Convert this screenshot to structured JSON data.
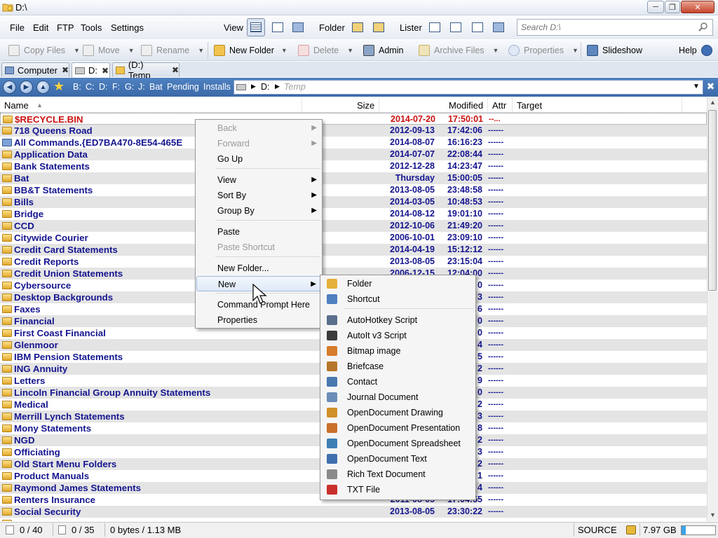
{
  "window": {
    "title": "D:\\"
  },
  "menu": {
    "items": [
      "File",
      "Edit",
      "FTP",
      "Tools",
      "Settings"
    ]
  },
  "toolbar_groups": {
    "view_label": "View",
    "folder_label": "Folder",
    "lister_label": "Lister"
  },
  "search": {
    "placeholder": "Search D:\\"
  },
  "actions": {
    "copy_files": "Copy Files",
    "move": "Move",
    "rename": "Rename",
    "new_folder": "New Folder",
    "delete": "Delete",
    "admin": "Admin",
    "archive_files": "Archive Files",
    "properties": "Properties",
    "slideshow": "Slideshow",
    "help": "Help"
  },
  "tabs": [
    {
      "label": "Computer"
    },
    {
      "label": "D:"
    },
    {
      "label": "(D:) Temp"
    }
  ],
  "pathbar": {
    "drives": [
      "B:",
      "C:",
      "D:",
      "F:",
      "G:",
      "J:"
    ],
    "bookmarks": [
      "Bat",
      "Pending",
      "Installs"
    ],
    "current_drive": "D:",
    "current_folder": "Temp"
  },
  "columns": {
    "name": "Name",
    "size": "Size",
    "modified": "Modified",
    "attr": "Attr",
    "target": "Target"
  },
  "files": [
    {
      "name": "$RECYCLE.BIN",
      "date": "2014-07-20",
      "time": "17:50:01",
      "attr": "--..."
    },
    {
      "name": "718 Queens Road",
      "date": "2012-09-13",
      "time": "17:42:06",
      "attr": "------"
    },
    {
      "name": "All Commands.{ED7BA470-8E54-465E",
      "date": "2014-08-07",
      "time": "16:16:23",
      "attr": "------"
    },
    {
      "name": "Application Data",
      "date": "2014-07-07",
      "time": "22:08:44",
      "attr": "------"
    },
    {
      "name": "Bank Statements",
      "date": "2012-12-28",
      "time": "14:23:47",
      "attr": "------"
    },
    {
      "name": "Bat",
      "date": "Thursday",
      "time": "15:00:05",
      "attr": "------"
    },
    {
      "name": "BB&T Statements",
      "date": "2013-08-05",
      "time": "23:48:58",
      "attr": "------"
    },
    {
      "name": "Bills",
      "date": "2014-03-05",
      "time": "10:48:53",
      "attr": "------"
    },
    {
      "name": "Bridge",
      "date": "2014-08-12",
      "time": "19:01:10",
      "attr": "------"
    },
    {
      "name": "CCD",
      "date": "2012-10-06",
      "time": "21:49:20",
      "attr": "------"
    },
    {
      "name": "Citywide Courier",
      "date": "2006-10-01",
      "time": "23:09:10",
      "attr": "------"
    },
    {
      "name": "Credit Card Statements",
      "date": "2014-04-19",
      "time": "15:12:12",
      "attr": "------"
    },
    {
      "name": "Credit Reports",
      "date": "2013-08-05",
      "time": "23:15:04",
      "attr": "------"
    },
    {
      "name": "Credit Union Statements",
      "date": "2006-12-15",
      "time": "12:04:00",
      "attr": "------"
    },
    {
      "name": "Cybersource",
      "date": "",
      "time": "0",
      "attr": "------"
    },
    {
      "name": "Desktop Backgrounds",
      "date": "",
      "time": "3",
      "attr": "------"
    },
    {
      "name": "Faxes",
      "date": "",
      "time": "6",
      "attr": "------"
    },
    {
      "name": "Financial",
      "date": "",
      "time": "0",
      "attr": "------"
    },
    {
      "name": "First Coast Financial",
      "date": "",
      "time": "0",
      "attr": "------"
    },
    {
      "name": "Glenmoor",
      "date": "",
      "time": "4",
      "attr": "------"
    },
    {
      "name": "IBM Pension Statements",
      "date": "",
      "time": "5",
      "attr": "------"
    },
    {
      "name": "ING Annuity",
      "date": "",
      "time": "2",
      "attr": "------"
    },
    {
      "name": "Letters",
      "date": "",
      "time": "9",
      "attr": "------"
    },
    {
      "name": "Lincoln Financial Group Annuity Statements",
      "date": "",
      "time": "0",
      "attr": "------"
    },
    {
      "name": "Medical",
      "date": "",
      "time": "2",
      "attr": "------"
    },
    {
      "name": "Merrill Lynch Statements",
      "date": "",
      "time": "3",
      "attr": "------"
    },
    {
      "name": "Mony Statements",
      "date": "",
      "time": "8",
      "attr": "------"
    },
    {
      "name": "NGD",
      "date": "",
      "time": "2",
      "attr": "------"
    },
    {
      "name": "Officiating",
      "date": "",
      "time": "3",
      "attr": "------"
    },
    {
      "name": "Old Start Menu Folders",
      "date": "",
      "time": "2",
      "attr": "------"
    },
    {
      "name": "Product Manuals",
      "date": "",
      "time": "1",
      "attr": "------"
    },
    {
      "name": "Raymond James Statements",
      "date": "",
      "time": "4",
      "attr": "------"
    },
    {
      "name": "Renters Insurance",
      "date": "2011-08-05",
      "time": "17:04:55",
      "attr": "------"
    },
    {
      "name": "Social Security",
      "date": "2013-08-05",
      "time": "23:30:22",
      "attr": "------"
    },
    {
      "name": "",
      "date": "",
      "time": "",
      "attr": ""
    }
  ],
  "context_menu": [
    {
      "label": "Back",
      "disabled": true,
      "submenu": true
    },
    {
      "label": "Forward",
      "disabled": true,
      "submenu": true
    },
    {
      "label": "Go Up"
    },
    {
      "label": "View",
      "submenu": true
    },
    {
      "label": "Sort By",
      "submenu": true
    },
    {
      "label": "Group By",
      "submenu": true
    },
    {
      "label": "Paste"
    },
    {
      "label": "Paste Shortcut",
      "disabled": true
    },
    {
      "label": "New Folder..."
    },
    {
      "label": "New",
      "submenu": true
    },
    {
      "label": "Command Prompt Here"
    },
    {
      "label": "Properties"
    }
  ],
  "new_submenu": [
    {
      "label": "Folder",
      "icon": "folder-icon",
      "color": "#e6b13a"
    },
    {
      "label": "Shortcut",
      "icon": "shortcut-icon",
      "color": "#4e7fbf"
    },
    {
      "label": "AutoHotkey Script",
      "icon": "ahk-script-icon",
      "color": "#5a6f8c"
    },
    {
      "label": "AutoIt v3 Script",
      "icon": "autoit-script-icon",
      "color": "#3b3b3b"
    },
    {
      "label": "Bitmap image",
      "icon": "bitmap-icon",
      "color": "#d77b2c"
    },
    {
      "label": "Briefcase",
      "icon": "briefcase-icon",
      "color": "#b7772a"
    },
    {
      "label": "Contact",
      "icon": "contact-icon",
      "color": "#4a78b0"
    },
    {
      "label": "Journal Document",
      "icon": "journal-icon",
      "color": "#6b8db8"
    },
    {
      "label": "OpenDocument Drawing",
      "icon": "odg-icon",
      "color": "#d0902a"
    },
    {
      "label": "OpenDocument Presentation",
      "icon": "odp-icon",
      "color": "#c96f2a"
    },
    {
      "label": "OpenDocument Spreadsheet",
      "icon": "ods-icon",
      "color": "#3d7fb5"
    },
    {
      "label": "OpenDocument Text",
      "icon": "odt-icon",
      "color": "#3f6fae"
    },
    {
      "label": "Rich Text Document",
      "icon": "rtf-icon",
      "color": "#8a8a8a"
    },
    {
      "label": "TXT File",
      "icon": "txt-icon",
      "color": "#c9302c"
    }
  ],
  "status": {
    "dirs": "0 / 40",
    "files": "0 / 35",
    "bytes": "0 bytes / 1.13 MB",
    "source": "SOURCE",
    "free": "7.97 GB",
    "free_fraction": 0.12
  },
  "colors": {
    "folder_text": "#15158f",
    "system_text": "#cc1010",
    "pathbar": "#3b69a8"
  }
}
